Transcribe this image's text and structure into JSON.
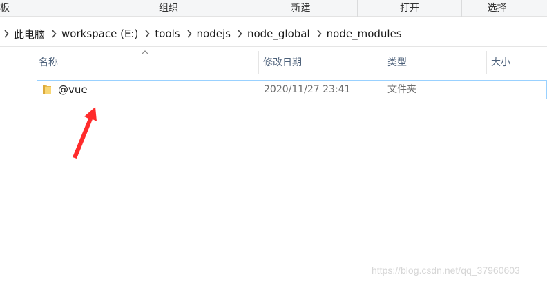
{
  "ribbon": {
    "groups": [
      "板",
      "组织",
      "新建",
      "打开",
      "选择"
    ]
  },
  "address": {
    "crumbs": [
      "此电脑",
      "workspace (E:)",
      "tools",
      "nodejs",
      "node_global",
      "node_modules"
    ]
  },
  "columns": {
    "name": "名称",
    "modified": "修改日期",
    "type": "类型",
    "size": "大小"
  },
  "files": [
    {
      "name": "@vue",
      "modified": "2020/11/27 23:41",
      "type": "文件夹",
      "icon": "folder-icon"
    }
  ],
  "annotation": {
    "icon": "red-arrow",
    "color": "#ff2b2b"
  },
  "watermark": "https://blog.csdn.net/qq_37960603",
  "colors": {
    "selection_border": "#99d1ff",
    "header_text": "#4c607a"
  }
}
